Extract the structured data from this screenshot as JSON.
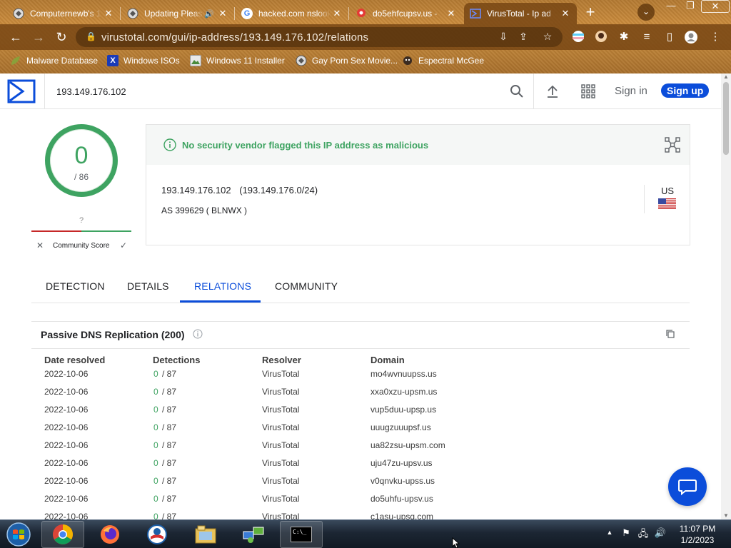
{
  "browser": {
    "tabs": [
      {
        "title": "Computernewb's 1",
        "favicon": "vm-icon"
      },
      {
        "title": "Updating Please",
        "favicon": "vm-icon",
        "audio": "🔊"
      },
      {
        "title": "hacked.com nslook",
        "favicon": "google-icon"
      },
      {
        "title": "do5ehfcupsv.us - ",
        "favicon": "maps-pin-icon"
      },
      {
        "title": "VirusTotal - Ip ad",
        "favicon": "virustotal-icon"
      }
    ],
    "new_tab": "+",
    "tab_menu": "⌄",
    "window": {
      "minimize": "—",
      "maximize": "❐",
      "close": "✕"
    },
    "nav": {
      "back": "←",
      "forward": "→",
      "reload": "↻"
    },
    "url": "virustotal.com/gui/ip-address/193.149.176.102/relations",
    "bookmarks": [
      {
        "label": "Malware Database",
        "icon": "leaf-icon"
      },
      {
        "label": "Windows ISOs",
        "icon": "x-icon"
      },
      {
        "label": "Windows 11 Installer",
        "icon": "image-icon"
      },
      {
        "label": "Gay Porn Sex Movie...",
        "icon": "vm-icon"
      },
      {
        "label": "Espectral McGee",
        "icon": "mask-icon"
      }
    ]
  },
  "vt": {
    "search_query": "193.149.176.102",
    "sign_in": "Sign in",
    "sign_up": "Sign up",
    "score": {
      "detections": "0",
      "total": "/ 86"
    },
    "community": {
      "value": "?",
      "label": "Community Score"
    },
    "banner": "No security vendor flagged this IP address as malicious",
    "ip": "193.149.176.102",
    "cidr": "(193.149.176.0/24)",
    "as": "AS 399629 ( BLNWX )",
    "country": "US",
    "tabs": [
      "DETECTION",
      "DETAILS",
      "RELATIONS",
      "COMMUNITY"
    ],
    "active_tab": "RELATIONS",
    "passive_dns": {
      "title": "Passive DNS Replication (200)",
      "headers": [
        "Date resolved",
        "Detections",
        "Resolver",
        "Domain"
      ],
      "rows": [
        {
          "date": "2022-10-06",
          "det": "0",
          "total": "/ 87",
          "resolver": "VirusTotal",
          "domain": "mo4wvnuupss.us"
        },
        {
          "date": "2022-10-06",
          "det": "0",
          "total": "/ 87",
          "resolver": "VirusTotal",
          "domain": "xxa0xzu-upsm.us"
        },
        {
          "date": "2022-10-06",
          "det": "0",
          "total": "/ 87",
          "resolver": "VirusTotal",
          "domain": "vup5duu-upsp.us"
        },
        {
          "date": "2022-10-06",
          "det": "0",
          "total": "/ 87",
          "resolver": "VirusTotal",
          "domain": "uuugzuuupsf.us"
        },
        {
          "date": "2022-10-06",
          "det": "0",
          "total": "/ 87",
          "resolver": "VirusTotal",
          "domain": "ua82zsu-upsm.com"
        },
        {
          "date": "2022-10-06",
          "det": "0",
          "total": "/ 87",
          "resolver": "VirusTotal",
          "domain": "uju47zu-upsv.us"
        },
        {
          "date": "2022-10-06",
          "det": "0",
          "total": "/ 87",
          "resolver": "VirusTotal",
          "domain": "v0qnvku-upss.us"
        },
        {
          "date": "2022-10-06",
          "det": "0",
          "total": "/ 87",
          "resolver": "VirusTotal",
          "domain": "do5uhfu-upsv.us"
        },
        {
          "date": "2022-10-06",
          "det": "0",
          "total": "/ 87",
          "resolver": "VirusTotal",
          "domain": "c1asu-upsq.com"
        }
      ]
    }
  },
  "taskbar": {
    "items": [
      "chrome-icon",
      "firefox-icon",
      "obama-icon",
      "file-explorer-icon",
      "network-icon",
      "cmd-icon"
    ],
    "cmd_label": "C:\\_",
    "clock": {
      "time": "11:07 PM",
      "date": "1/2/2023"
    }
  },
  "colors": {
    "vt_blue": "#0b4dda",
    "clean_green": "#3ea361",
    "chrome_brown": "#b47a32"
  }
}
